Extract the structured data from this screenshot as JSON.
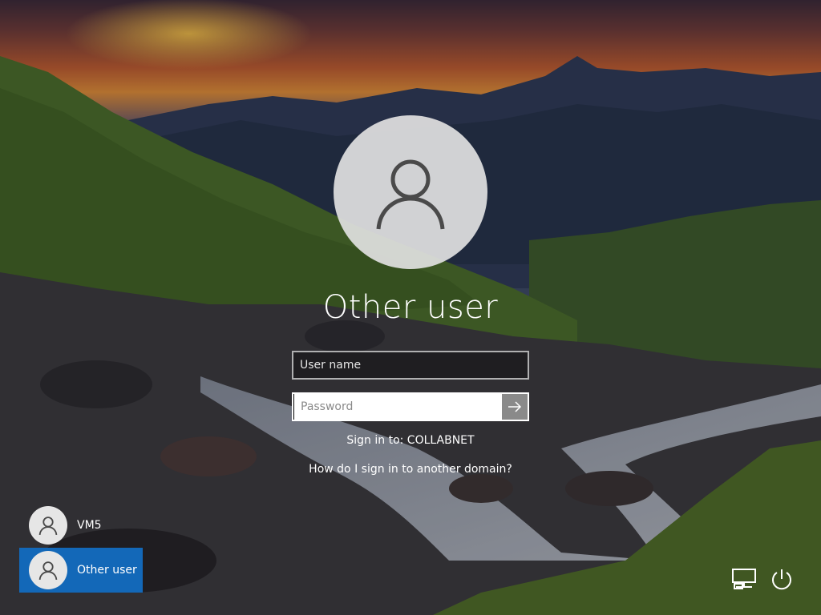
{
  "login": {
    "title": "Other user",
    "username_placeholder": "User name",
    "username_value": "",
    "password_placeholder": "Password",
    "password_value": "",
    "sign_in_to": "Sign in to: COLLABNET",
    "domain_help_link": "How do I sign in to another domain?"
  },
  "user_list": [
    {
      "name": "VM5",
      "selected": false
    },
    {
      "name": "Other user",
      "selected": true
    }
  ],
  "tray": {
    "network_icon": "network-icon",
    "power_icon": "power-icon"
  },
  "colors": {
    "selected_tile": "#1368b8",
    "submit_button": "#8a8a8a",
    "avatar_circle": "#e1e1e1"
  }
}
